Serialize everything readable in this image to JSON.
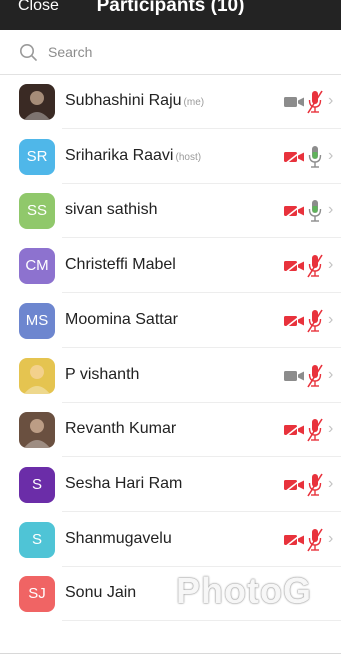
{
  "header": {
    "close_label": "Close",
    "title": "Participants (10)"
  },
  "search": {
    "placeholder": "Search",
    "icon": "search-icon"
  },
  "participants": [
    {
      "name": "Subhashini Raju",
      "tag": "(me)",
      "avatar_type": "photo",
      "initials": "",
      "avatar_color": "#3a2a24",
      "video": "off-gray",
      "mic": "muted"
    },
    {
      "name": "Sriharika Raavi",
      "tag": "(host)",
      "avatar_type": "initials",
      "initials": "SR",
      "avatar_color": "#4fb7e9",
      "video": "off",
      "mic": "on"
    },
    {
      "name": "sivan sathish",
      "tag": "",
      "avatar_type": "initials",
      "initials": "SS",
      "avatar_color": "#90c86b",
      "video": "off",
      "mic": "on"
    },
    {
      "name": "Christeffi Mabel",
      "tag": "",
      "avatar_type": "initials",
      "initials": "CM",
      "avatar_color": "#8d72cf",
      "video": "off",
      "mic": "muted"
    },
    {
      "name": "Moomina Sattar",
      "tag": "",
      "avatar_type": "initials",
      "initials": "MS",
      "avatar_color": "#6d86cf",
      "video": "off",
      "mic": "muted"
    },
    {
      "name": "P vishanth",
      "tag": "",
      "avatar_type": "photo",
      "initials": "",
      "avatar_color": "#e5c450",
      "video": "off-gray",
      "mic": "muted"
    },
    {
      "name": "Revanth Kumar",
      "tag": "",
      "avatar_type": "photo",
      "initials": "",
      "avatar_color": "#6a5040",
      "video": "off",
      "mic": "muted"
    },
    {
      "name": "Sesha Hari Ram",
      "tag": "",
      "avatar_type": "initials",
      "initials": "S",
      "avatar_color": "#6b2da8",
      "video": "off",
      "mic": "muted"
    },
    {
      "name": "Shanmugavelu",
      "tag": "",
      "avatar_type": "initials",
      "initials": "S",
      "avatar_color": "#4fc4d6",
      "video": "off",
      "mic": "muted"
    },
    {
      "name": "Sonu Jain",
      "tag": "",
      "avatar_type": "initials",
      "initials": "SJ",
      "avatar_color": "#f06464",
      "video": "none",
      "mic": "none"
    }
  ],
  "watermark": {
    "text": "PhotoG"
  },
  "colors": {
    "header_bg": "#232323",
    "muted_red": "#e8323c",
    "icon_gray": "#8c8c8c"
  }
}
